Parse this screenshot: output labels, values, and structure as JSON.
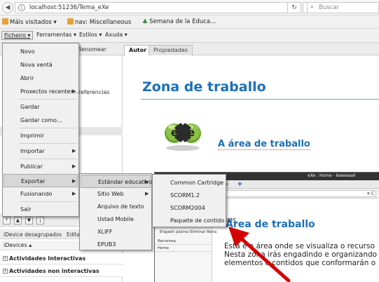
{
  "browser": {
    "url": "localhost:51236/Tema_eXe",
    "search_placeholder": "Buscar",
    "bookmarks": [
      {
        "label": "Máis visitados ▾"
      },
      {
        "label": "nav: Miscellaneous"
      },
      {
        "label": "Semana de la Educa..."
      }
    ]
  },
  "menubar": {
    "items": [
      "Ficheiro ▾",
      "Ferramentas ▾",
      "Estilos ▾",
      "Axuda ▾"
    ]
  },
  "left_pane": {
    "rename_tab": "Renomear",
    "tree_text": "referencias",
    "idevice_tabs": [
      "iDevice desagrupados",
      "Edita"
    ],
    "idevices_header": "iDevices ▴",
    "categories": [
      "Actividades Interactivas",
      "Actividades non interactivas"
    ]
  },
  "main": {
    "tabs": [
      "Autor",
      "Propiedades"
    ],
    "title": "Zona de traballo",
    "heading": "A área de traballo"
  },
  "embedded_screenshot": {
    "title": "eXe : Home - keweasel",
    "url_text": "ckage",
    "heading": "Área de traballo",
    "left_menu": "Engadir páxina   Eliminar   Rena",
    "left_rows": [
      "Renomea",
      "Home"
    ],
    "body_lines": [
      "Está é a área onde se visualiza o recurso",
      "Nesta zona irás engadindo e organizando",
      "elementos e contidos que conformarán o"
    ]
  },
  "file_menu": {
    "items": [
      "Novo",
      "Nova ventá",
      "Abrir",
      "Proxectos recentes...",
      "Gardar",
      "Gardar como...",
      "Imprimir",
      "Importar",
      "Publicar",
      "Exportar",
      "Fusionando",
      "Saír"
    ]
  },
  "export_menu": {
    "items": [
      "Estándar educativo",
      "Sitio Web",
      "Arquivo de texto",
      "Ustad Mobile",
      "XLIFF",
      "EPUB3"
    ]
  },
  "standard_menu": {
    "items": [
      "Common Cartridge",
      "SCORM1.2",
      "SCORM2004",
      "Paquete de contido IMS"
    ]
  },
  "colors": {
    "heading_blue": "#1b6fb8",
    "arrow_red": "#d40000"
  }
}
